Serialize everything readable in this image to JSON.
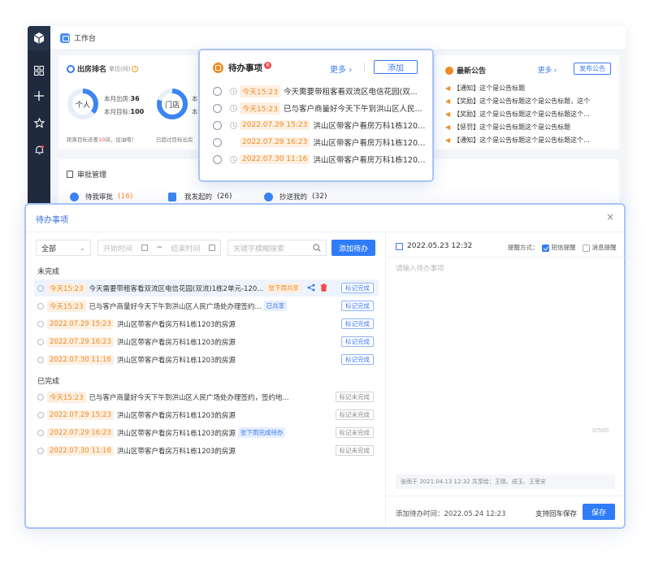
{
  "workspace": {
    "title": "工作台",
    "ranking": {
      "title": "出房排名",
      "unit": "单位(间)",
      "personal": {
        "label": "个人",
        "month_out_label": "本月出房:",
        "month_out": "36",
        "month_target_label": "本月目标:",
        "month_target": "100"
      },
      "store": {
        "label": "门店",
        "month_out_label": "本",
        "month_target_label": "本"
      },
      "personal_note": {
        "prefix": "距离目标还差",
        "count": "10",
        "suffix": "间，加油哦！"
      },
      "store_note": "已超过目标出房"
    },
    "approval": {
      "title": "审批管理",
      "items": [
        {
          "label": "待我审批",
          "count": "(16)"
        },
        {
          "label": "我发起的",
          "count": "(26)"
        },
        {
          "label": "抄送我的",
          "count": "(32)"
        }
      ]
    },
    "notice": {
      "title": "最新公告",
      "more": "更多",
      "publish": "发布公告",
      "items": [
        "【通知】这个是公告标题",
        "【奖励】这个是公告标题这个是公告标题，这个",
        "【奖励】这个是公告标题这个是公告标题这个...",
        "【惩罚】这个是公告标题这个是公告标题",
        "【通知】这个是公告标题这个是公告标题这个..."
      ]
    }
  },
  "popup": {
    "title": "待办事项",
    "badge": "8",
    "more": "更多",
    "add": "添加",
    "items": [
      {
        "time": "今天15:23",
        "text": "今天需要带租客看双流区电信花园(双..."
      },
      {
        "time": "今天15:23",
        "text": "已与客户商量好今天下午到洪山区人民..."
      },
      {
        "time": "2022.07.29 15:23",
        "text": "洪山区带客户看房万科1栋1203..."
      },
      {
        "time": "2022.07.29 16:23",
        "text": "洪山区带客户看房万科1栋1203..."
      },
      {
        "time": "2022.07.30 11:16",
        "text": "洪山区带客户看房万科1栋1203..."
      }
    ]
  },
  "dialog": {
    "title": "待办事项",
    "close": "×",
    "filter": {
      "select": "全部",
      "start_placeholder": "开始时间",
      "range_sep": "~",
      "end_placeholder": "结束时间",
      "search_placeholder": "关键字模糊搜索",
      "add_button": "添加待办"
    },
    "pending_title": "未完成",
    "pending": [
      {
        "time": "今天15:23",
        "text": "今天需要带租客看双流区电信花园(双流)1栋2单元-120...",
        "tag": "张下雨共享",
        "action": "标记完成"
      },
      {
        "time": "今天15:23",
        "text": "已与客户商量好今天下午到洪山区人民广场处办理签约...",
        "tag": "已共享",
        "action": "标记完成"
      },
      {
        "time": "2022.07.29 15:23",
        "text": "洪山区带客户看房万科1栋1203的房源",
        "tag": "",
        "action": "标记完成"
      },
      {
        "time": "2022.07.29 16:23",
        "text": "洪山区带客户看房万科1栋1203的房源",
        "tag": "",
        "action": "标记完成"
      },
      {
        "time": "2022.07.30 11:16",
        "text": "洪山区带客户看房万科1栋1203的房源",
        "tag": "",
        "action": "标记完成"
      }
    ],
    "done_title": "已完成",
    "done": [
      {
        "time": "今天15:23",
        "text": "已与客户商量好今天下午到洪山区人民广场处办理签约，签约地...",
        "tag": "",
        "action": "标记未完成"
      },
      {
        "time": "2022.07.29 15:23",
        "text": "洪山区带客户看房万科1栋1203的房源",
        "tag": "",
        "action": "标记未完成"
      },
      {
        "time": "2022.07.29 16:23",
        "text": "洪山区带客户看房万科1栋1203的房源",
        "tag": "张下雨完成待办",
        "action": "标记未完成"
      },
      {
        "time": "2022.07.30 11:16",
        "text": "洪山区带客户看房万科1栋1203的房源",
        "tag": "",
        "action": "标记未完成"
      }
    ],
    "editor": {
      "date": "2022.05.23 12:32",
      "remind_label": "提醒方式：",
      "sms_label": "短信提醒",
      "msg_label": "消息提醒",
      "placeholder": "请输入待办事项",
      "counter": "0/500",
      "footer_info": "张雨于 2021.04.13 12:32 共享给：王晓、成玉、王思安",
      "added_time_label": "添加待办时间：",
      "added_time": "2022.05.24 12:23",
      "enter_hint": "支持回车保存",
      "save": "保存"
    }
  },
  "colors": {
    "primary": "#2f7cf6",
    "orange": "#f08a24",
    "sidebar": "#1f2a3d"
  }
}
